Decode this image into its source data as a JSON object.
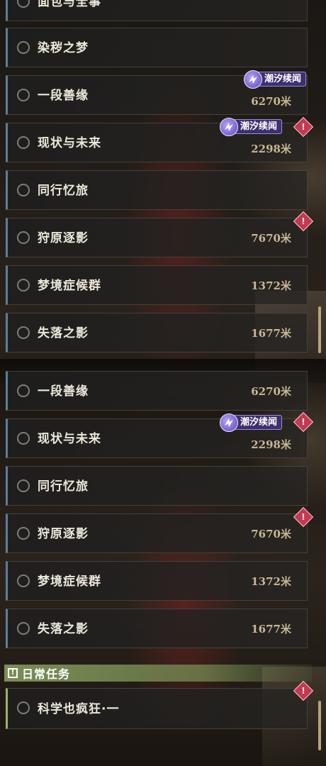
{
  "panel_top": {
    "quests": [
      {
        "title": "面包与全事",
        "distance": "",
        "tag": "",
        "alert": false
      },
      {
        "title": "染秽之梦",
        "distance": "",
        "tag": "",
        "alert": false
      },
      {
        "title": "一段善缘",
        "distance": "6270米",
        "tag": "潮汐续闻",
        "alert": false
      },
      {
        "title": "现状与未来",
        "distance": "2298米",
        "tag": "潮汐续闻",
        "alert": true
      },
      {
        "title": "同行忆旅",
        "distance": "",
        "tag": "",
        "alert": false
      },
      {
        "title": "狩原逐影",
        "distance": "7670米",
        "tag": "",
        "alert": true
      },
      {
        "title": "梦境症候群",
        "distance": "1372米",
        "tag": "",
        "alert": false
      },
      {
        "title": "失落之影",
        "distance": "1677米",
        "tag": "",
        "alert": false
      }
    ]
  },
  "panel_bottom": {
    "quests": [
      {
        "title": "一段善缘",
        "distance": "6270米",
        "tag": "",
        "alert": false
      },
      {
        "title": "现状与未来",
        "distance": "2298米",
        "tag": "潮汐续闻",
        "alert": true
      },
      {
        "title": "同行忆旅",
        "distance": "",
        "tag": "",
        "alert": false
      },
      {
        "title": "狩原逐影",
        "distance": "7670米",
        "tag": "",
        "alert": true
      },
      {
        "title": "梦境症候群",
        "distance": "1372米",
        "tag": "",
        "alert": false
      },
      {
        "title": "失落之影",
        "distance": "1677米",
        "tag": "",
        "alert": false
      }
    ],
    "daily_section": {
      "label": "日常任务",
      "icon": "exclamation-box-icon"
    },
    "daily_quests": [
      {
        "title": "科学也疯狂·一",
        "distance": "",
        "tag": "",
        "alert": true
      }
    ]
  },
  "icons": {
    "alert": "!",
    "section": "!"
  },
  "colors": {
    "card_accent": "#5c7f96",
    "daily_accent": "#9eb070",
    "tag_bg": "#3e2f6e",
    "alert": "#c33950",
    "distance_text": "#c9b795"
  }
}
